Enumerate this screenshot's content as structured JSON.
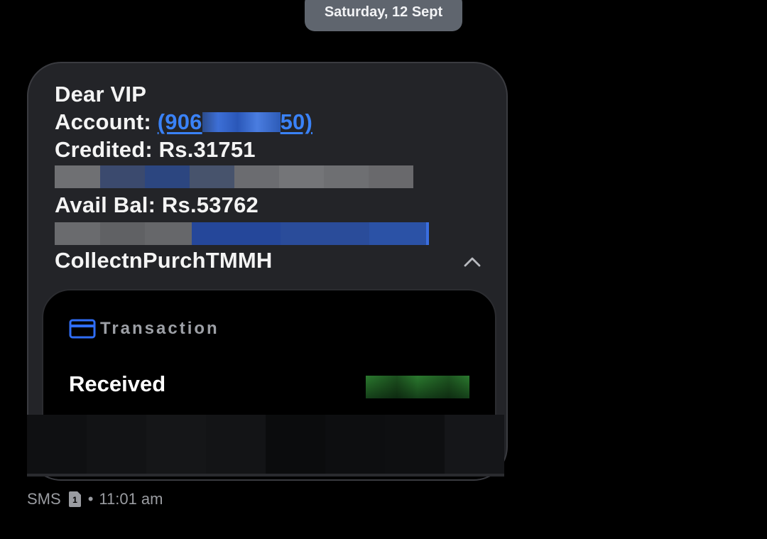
{
  "date_header": "Saturday, 12 Sept",
  "message": {
    "line1": "Dear VIP",
    "account_label": "Account: ",
    "account_open": "(906",
    "account_close": "50)",
    "credited": "Credited: Rs.31751",
    "avail_bal": "Avail Bal: Rs.53762",
    "sender_ref": "CollectnPurchTMMH"
  },
  "transaction_card": {
    "label": "Transaction",
    "icon": "credit-card-icon",
    "status": "Received"
  },
  "footer": {
    "channel": "SMS",
    "sim_icon": "sim-1-icon",
    "separator": "•",
    "time": "11:01 am"
  },
  "colors": {
    "background": "#000000",
    "bubble": "#232428",
    "link_blue": "#3a82f7",
    "date_pill": "#5f656e"
  }
}
